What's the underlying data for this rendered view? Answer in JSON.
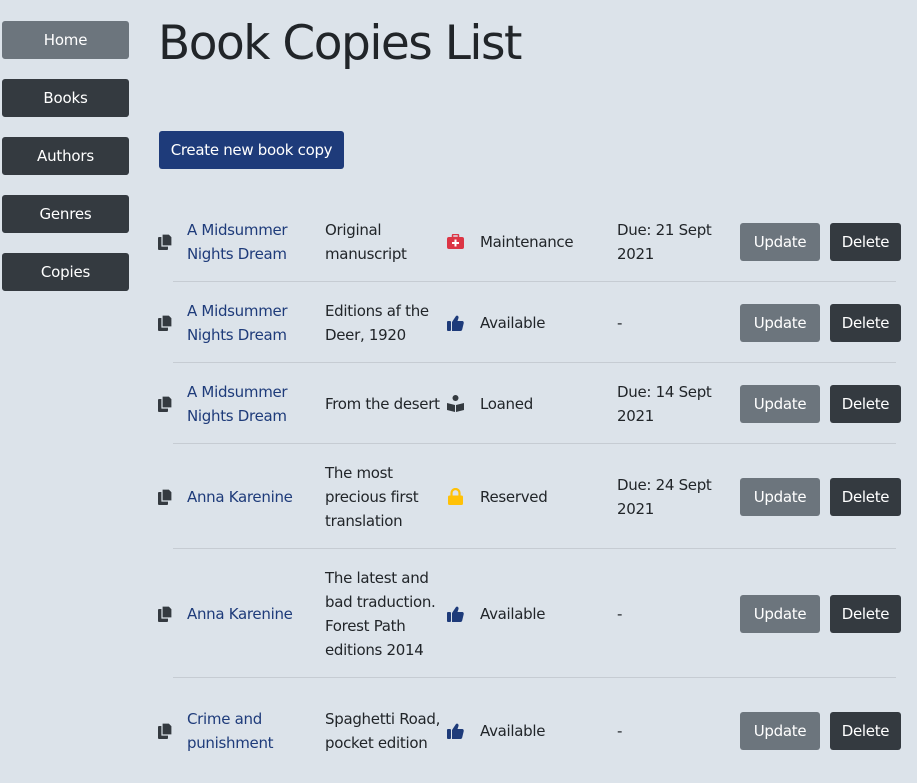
{
  "sidebar": {
    "items": [
      {
        "label": "Home",
        "active": true
      },
      {
        "label": "Books",
        "active": false
      },
      {
        "label": "Authors",
        "active": false
      },
      {
        "label": "Genres",
        "active": false
      },
      {
        "label": "Copies",
        "active": false
      }
    ]
  },
  "page": {
    "title": "Book Copies List",
    "create_label": "Create new book copy"
  },
  "colors": {
    "background": "#dce3ea",
    "primary": "#1e3b7a",
    "nav_active": "#6c757d",
    "nav_default": "#343a40",
    "maintenance_icon": "#dc3545",
    "reserved_icon": "#ffc107",
    "available_icon": "#1e3b7a",
    "loaned_icon": "#343a40"
  },
  "copies": [
    {
      "title": "A Midsummer Nights Dream",
      "edition": "Original manuscript",
      "status": "Maintenance",
      "status_icon": "first-aid-kit-icon",
      "due": "Due: 21 Sept 2021",
      "update_label": "Update",
      "delete_label": "Delete"
    },
    {
      "title": "A Midsummer Nights Dream",
      "edition": "Editions af the Deer, 1920",
      "status": "Available",
      "status_icon": "thumbs-up-icon",
      "due": "-",
      "update_label": "Update",
      "delete_label": "Delete"
    },
    {
      "title": "A Midsummer Nights Dream",
      "edition": "From the desert",
      "status": "Loaned",
      "status_icon": "reading-person-icon",
      "due": "Due: 14 Sept 2021",
      "update_label": "Update",
      "delete_label": "Delete"
    },
    {
      "title": "Anna Karenine",
      "edition": "The most precious first translation",
      "status": "Reserved",
      "status_icon": "lock-icon",
      "due": "Due: 24 Sept 2021",
      "update_label": "Update",
      "delete_label": "Delete"
    },
    {
      "title": "Anna Karenine",
      "edition": "The latest and bad traduction. Forest Path editions 2014",
      "status": "Available",
      "status_icon": "thumbs-up-icon",
      "due": "-",
      "update_label": "Update",
      "delete_label": "Delete"
    },
    {
      "title": "Crime and punishment",
      "edition": "Spaghetti Road, pocket edition",
      "status": "Available",
      "status_icon": "thumbs-up-icon",
      "due": "-",
      "update_label": "Update",
      "delete_label": "Delete"
    }
  ]
}
